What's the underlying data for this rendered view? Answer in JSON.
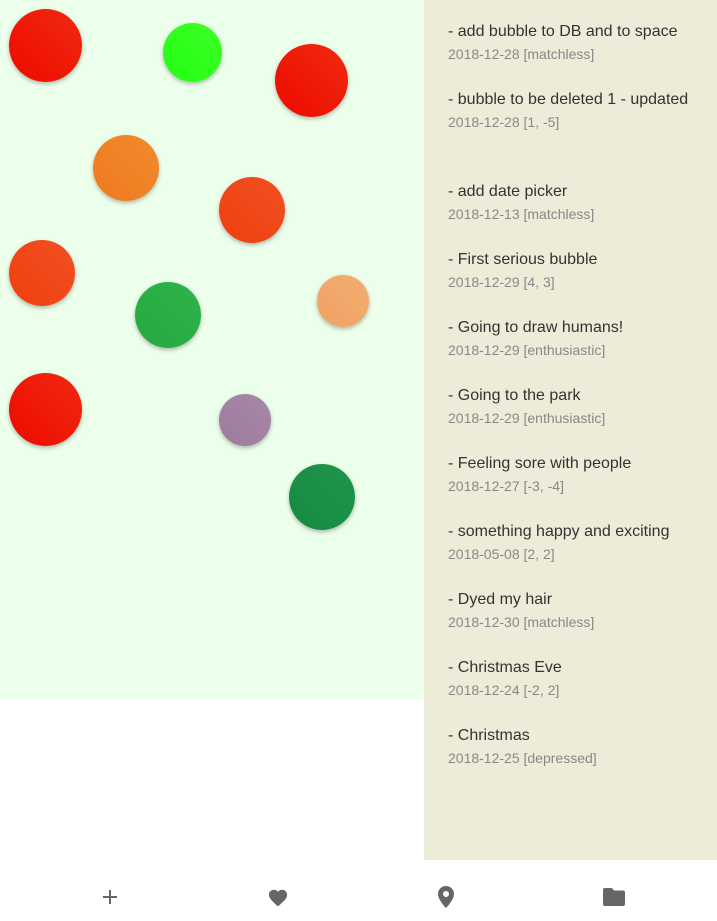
{
  "canvas": {
    "background": "#ecffea",
    "bubbles": [
      {
        "color": "#ee0a00",
        "gradient": "#f02a10"
      },
      {
        "color": "#22ff12",
        "gradient": "#3dff26"
      },
      {
        "color": "#ee0a00",
        "gradient": "#f02a10"
      },
      {
        "color": "#ef7a20",
        "gradient": "#f08a2c"
      },
      {
        "color": "#ef3f10",
        "gradient": "#f25020"
      },
      {
        "color": "#ef3f10",
        "gradient": "#f25020"
      },
      {
        "color": "#25a840",
        "gradient": "#2eb34a"
      },
      {
        "color": "#f0a262",
        "gradient": "#f2ad72"
      },
      {
        "color": "#ee0a00",
        "gradient": "#f02a10"
      },
      {
        "color": "#9c7b9c",
        "gradient": "#a888a8"
      },
      {
        "color": "#168a42",
        "gradient": "#1f954b"
      }
    ]
  },
  "list": {
    "background": "#edecd8",
    "entries": [
      {
        "title": "- add bubble to DB and to space",
        "meta": "2018-12-28 [matchless]"
      },
      {
        "title": "- bubble to be deleted 1 - updated",
        "meta": "2018-12-28 [1, -5]"
      },
      {
        "title": "- add date picker",
        "meta": "2018-12-13 [matchless]"
      },
      {
        "title": "- First serious bubble",
        "meta": "2018-12-29 [4, 3]"
      },
      {
        "title": "- Going to draw humans!",
        "meta": "2018-12-29 [enthusiastic]"
      },
      {
        "title": "- Going to the park",
        "meta": "2018-12-29 [enthusiastic]"
      },
      {
        "title": "- Feeling sore with people",
        "meta": "2018-12-27 [-3, -4]"
      },
      {
        "title": "- something happy and exciting",
        "meta": "2018-05-08 [2, 2]"
      },
      {
        "title": "- Dyed my hair",
        "meta": "2018-12-30 [matchless]"
      },
      {
        "title": "- Christmas Eve",
        "meta": "2018-12-24 [-2, 2]"
      },
      {
        "title": "- Christmas",
        "meta": "2018-12-25 [depressed]"
      }
    ]
  },
  "nav": {
    "items": [
      {
        "icon": "plus-icon"
      },
      {
        "icon": "heart-icon"
      },
      {
        "icon": "location-pin-icon"
      },
      {
        "icon": "folder-icon"
      }
    ],
    "icon_color": "#666666"
  }
}
